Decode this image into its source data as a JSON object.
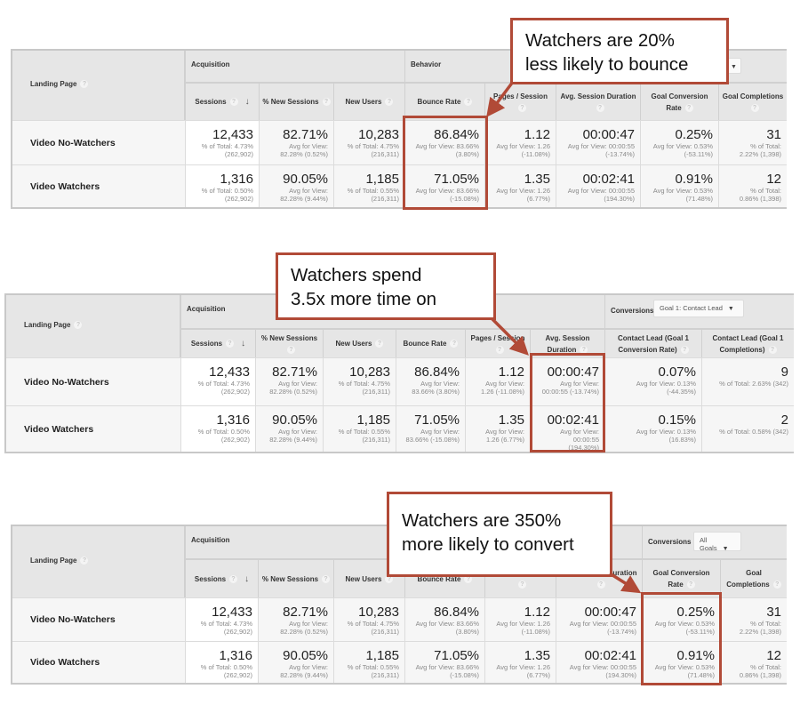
{
  "colors": {
    "accent": "#b14a37",
    "header_bg": "#e6e6e6",
    "row_bg": "#f6f6f6"
  },
  "tables": [
    {
      "landing_page_label": "Landing Page",
      "groups": {
        "acquisition": "Acquisition",
        "behavior": "Behavior",
        "conversions": ""
      },
      "headers": [
        "Sessions",
        "% New Sessions",
        "New Users",
        "Bounce Rate",
        "Pages / Session",
        "Avg. Session Duration",
        "Goal Conversion Rate",
        "Goal Completions"
      ],
      "rows": [
        {
          "label": "Video No-Watchers",
          "cells": [
            {
              "value": "12,433",
              "sub1": "% of Total: 4.73%",
              "sub2": "(262,902)"
            },
            {
              "value": "82.71%",
              "sub1": "Avg for View:",
              "sub2": "82.28% (0.52%)"
            },
            {
              "value": "10,283",
              "sub1": "% of Total: 4.75%",
              "sub2": "(216,311)"
            },
            {
              "value": "86.84%",
              "sub1": "Avg for View: 83.66%",
              "sub2": "(3.80%)"
            },
            {
              "value": "1.12",
              "sub1": "Avg for View: 1.26",
              "sub2": "(-11.08%)"
            },
            {
              "value": "00:00:47",
              "sub1": "Avg for View: 00:00:55",
              "sub2": "(-13.74%)"
            },
            {
              "value": "0.25%",
              "sub1": "Avg for View: 0.53%",
              "sub2": "(-53.11%)"
            },
            {
              "value": "31",
              "sub1": "% of Total:",
              "sub2": "2.22% (1,398)"
            }
          ]
        },
        {
          "label": "Video Watchers",
          "cells": [
            {
              "value": "1,316",
              "sub1": "% of Total: 0.50%",
              "sub2": "(262,902)"
            },
            {
              "value": "90.05%",
              "sub1": "Avg for View:",
              "sub2": "82.28% (9.44%)"
            },
            {
              "value": "1,185",
              "sub1": "% of Total: 0.55%",
              "sub2": "(216,311)"
            },
            {
              "value": "71.05%",
              "sub1": "Avg for View: 83.66%",
              "sub2": "(-15.08%)"
            },
            {
              "value": "1.35",
              "sub1": "Avg for View: 1.26",
              "sub2": "(6.77%)"
            },
            {
              "value": "00:02:41",
              "sub1": "Avg for View: 00:00:55",
              "sub2": "(194.30%)"
            },
            {
              "value": "0.91%",
              "sub1": "Avg for View: 0.53%",
              "sub2": "(71.48%)"
            },
            {
              "value": "12",
              "sub1": "% of Total:",
              "sub2": "0.86% (1,398)"
            }
          ]
        }
      ],
      "callout": {
        "line1": "Watchers are 20%",
        "line2": "less likely to bounce"
      }
    },
    {
      "landing_page_label": "Landing Page",
      "groups": {
        "acquisition": "Acquisition",
        "conversions": "Conversions",
        "goal_select": "Goal 1: Contact Lead"
      },
      "headers": [
        "Sessions",
        "% New Sessions",
        "New Users",
        "Bounce Rate",
        "Pages / Session",
        "Avg. Session Duration",
        "Contact Lead (Goal 1 Conversion Rate)",
        "Contact Lead (Goal 1 Completions)"
      ],
      "rows": [
        {
          "label": "Video No-Watchers",
          "cells": [
            {
              "value": "12,433",
              "sub1": "% of Total: 4.73%",
              "sub2": "(262,902)"
            },
            {
              "value": "82.71%",
              "sub1": "Avg for View:",
              "sub2": "82.28% (0.52%)"
            },
            {
              "value": "10,283",
              "sub1": "% of Total: 4.75%",
              "sub2": "(216,311)"
            },
            {
              "value": "86.84%",
              "sub1": "Avg for View:",
              "sub2": "83.66% (3.80%)"
            },
            {
              "value": "1.12",
              "sub1": "Avg for View:",
              "sub2": "1.26 (-11.08%)"
            },
            {
              "value": "00:00:47",
              "sub1": "Avg for View:",
              "sub2": "00:00:55 (-13.74%)"
            },
            {
              "value": "0.07%",
              "sub1": "Avg for View: 0.13%",
              "sub2": "(-44.35%)"
            },
            {
              "value": "9",
              "sub1": "% of Total: 2.63% (342)",
              "sub2": ""
            }
          ]
        },
        {
          "label": "Video Watchers",
          "cells": [
            {
              "value": "1,316",
              "sub1": "% of Total: 0.50%",
              "sub2": "(262,902)"
            },
            {
              "value": "90.05%",
              "sub1": "Avg for View:",
              "sub2": "82.28% (9.44%)"
            },
            {
              "value": "1,185",
              "sub1": "% of Total: 0.55%",
              "sub2": "(216,311)"
            },
            {
              "value": "71.05%",
              "sub1": "Avg for View:",
              "sub2": "83.66% (-15.08%)"
            },
            {
              "value": "1.35",
              "sub1": "Avg for View:",
              "sub2": "1.26 (6.77%)"
            },
            {
              "value": "00:02:41",
              "sub1": "Avg for View:",
              "sub2": "00:00:55",
              "sub3": "(194.30%)"
            },
            {
              "value": "0.15%",
              "sub1": "Avg for View: 0.13%",
              "sub2": "(16.83%)"
            },
            {
              "value": "2",
              "sub1": "% of Total: 0.58% (342)",
              "sub2": ""
            }
          ]
        }
      ],
      "callout": {
        "line1": "Watchers spend",
        "line2": "3.5x more time on"
      }
    },
    {
      "landing_page_label": "Landing Page",
      "groups": {
        "acquisition": "Acquisition",
        "conversions": "Conversions",
        "goal_select": "All Goals"
      },
      "headers": [
        "Sessions",
        "% New Sessions",
        "New Users",
        "Bounce Rate",
        "Pages / Session",
        "Avg. Session Duration",
        "Goal Conversion Rate",
        "Goal Completions"
      ],
      "rows": [
        {
          "label": "Video No-Watchers",
          "cells": [
            {
              "value": "12,433",
              "sub1": "% of Total: 4.73%",
              "sub2": "(262,902)"
            },
            {
              "value": "82.71%",
              "sub1": "Avg for View:",
              "sub2": "82.28% (0.52%)"
            },
            {
              "value": "10,283",
              "sub1": "% of Total: 4.75%",
              "sub2": "(216,311)"
            },
            {
              "value": "86.84%",
              "sub1": "Avg for View: 83.66%",
              "sub2": "(3.80%)"
            },
            {
              "value": "1.12",
              "sub1": "Avg for View: 1.26",
              "sub2": "(-11.08%)"
            },
            {
              "value": "00:00:47",
              "sub1": "Avg for View: 00:00:55",
              "sub2": "(-13.74%)"
            },
            {
              "value": "0.25%",
              "sub1": "Avg for View: 0.53%",
              "sub2": "(-53.11%)"
            },
            {
              "value": "31",
              "sub1": "% of Total:",
              "sub2": "2.22% (1,398)"
            }
          ]
        },
        {
          "label": "Video Watchers",
          "cells": [
            {
              "value": "1,316",
              "sub1": "% of Total: 0.50%",
              "sub2": "(262,902)"
            },
            {
              "value": "90.05%",
              "sub1": "Avg for View:",
              "sub2": "82.28% (9.44%)"
            },
            {
              "value": "1,185",
              "sub1": "% of Total: 0.55%",
              "sub2": "(216,311)"
            },
            {
              "value": "71.05%",
              "sub1": "Avg for View: 83.66%",
              "sub2": "(-15.08%)"
            },
            {
              "value": "1.35",
              "sub1": "Avg for View: 1.26",
              "sub2": "(6.77%)"
            },
            {
              "value": "00:02:41",
              "sub1": "Avg for View: 00:00:55",
              "sub2": "(194.30%)"
            },
            {
              "value": "0.91%",
              "sub1": "Avg for View: 0.53%",
              "sub2": "(71.48%)"
            },
            {
              "value": "12",
              "sub1": "% of Total:",
              "sub2": "0.86% (1,398)"
            }
          ]
        }
      ],
      "callout": {
        "line1": "Watchers are 350%",
        "line2": "more likely to convert"
      }
    }
  ]
}
